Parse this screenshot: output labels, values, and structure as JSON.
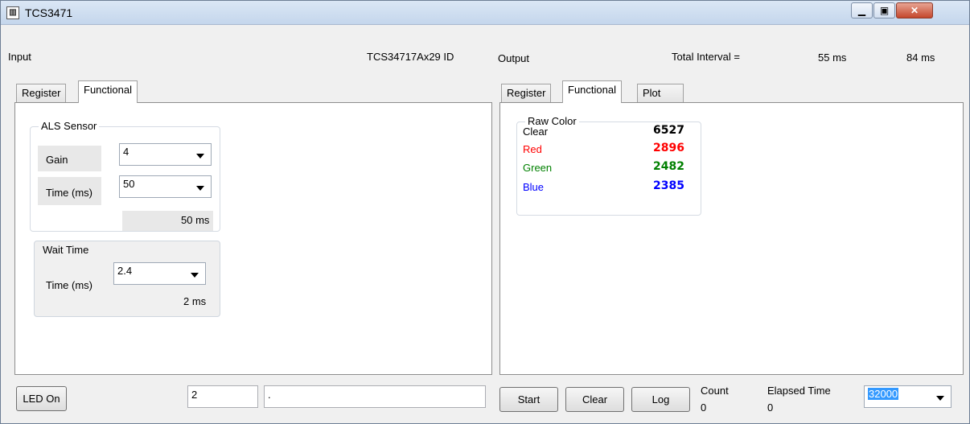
{
  "window": {
    "title": "TCS3471"
  },
  "header": {
    "input_label": "Input",
    "device_id": "TCS34717Ax29 ID",
    "output_label": "Output",
    "total_interval_label": "Total Interval =",
    "interval_1": "55 ms",
    "interval_2": "84 ms"
  },
  "left_tabs": [
    {
      "label": "Register",
      "active": false
    },
    {
      "label": "Functional",
      "active": true
    }
  ],
  "right_tabs": [
    {
      "label": "Register",
      "active": false
    },
    {
      "label": "Functional",
      "active": true
    },
    {
      "label": "Plot",
      "active": false
    }
  ],
  "als": {
    "title": "ALS Sensor",
    "gain_label": "Gain",
    "gain_value": "4",
    "time_label": "Time (ms)",
    "time_value": "50",
    "time_result": "50 ms"
  },
  "wait": {
    "title": "Wait Time",
    "time_label": "Time (ms)",
    "time_value": "2.4",
    "time_result": "2 ms"
  },
  "raw_color": {
    "title": "Raw Color",
    "rows": [
      {
        "label": "Clear",
        "value": "6527",
        "color": "#000000"
      },
      {
        "label": "Red",
        "value": "2896",
        "color": "#ff0000"
      },
      {
        "label": "Green",
        "value": "2482",
        "color": "#008000"
      },
      {
        "label": "Blue",
        "value": "2385",
        "color": "#0000ff"
      }
    ]
  },
  "bottom": {
    "led_button": "LED On",
    "field_1": "2",
    "field_2": ".",
    "start_button": "Start",
    "clear_button": "Clear",
    "log_button": "Log",
    "count_label": "Count",
    "count_value": "0",
    "elapsed_label": "Elapsed Time",
    "elapsed_value": "0",
    "interval_select": "32000"
  }
}
